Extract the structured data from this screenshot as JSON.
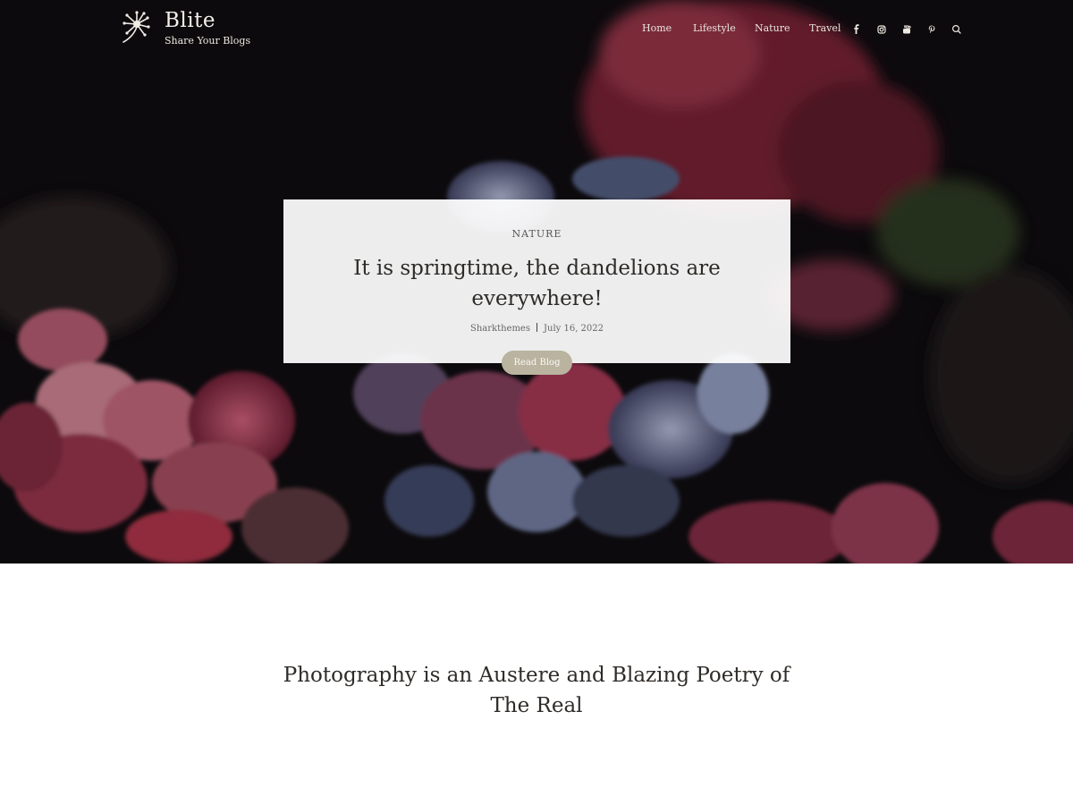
{
  "brand": {
    "title": "Blite",
    "tagline": "Share Your Blogs",
    "logo_icon": "dandelion-icon"
  },
  "nav": {
    "items": [
      {
        "label": "Home"
      },
      {
        "label": "Lifestyle"
      },
      {
        "label": "Nature"
      },
      {
        "label": "Travel"
      }
    ],
    "social": [
      "facebook-icon",
      "instagram-icon",
      "youtube-icon",
      "pinterest-icon"
    ],
    "search_icon": "search-icon"
  },
  "hero": {
    "category": "NATURE",
    "title": "It is springtime, the dandelions are everywhere!",
    "author": "Sharkthemes",
    "date": "July 16, 2022",
    "button_label": "Read Blog",
    "image_description_colors": {
      "dark": "#0d0b0d",
      "petal_red": "#8a2c44",
      "petal_blue": "#6f7c9e",
      "button": "#b9b39f"
    }
  },
  "section": {
    "title": "Photography is an Austere and Blazing Poetry of The Real"
  }
}
